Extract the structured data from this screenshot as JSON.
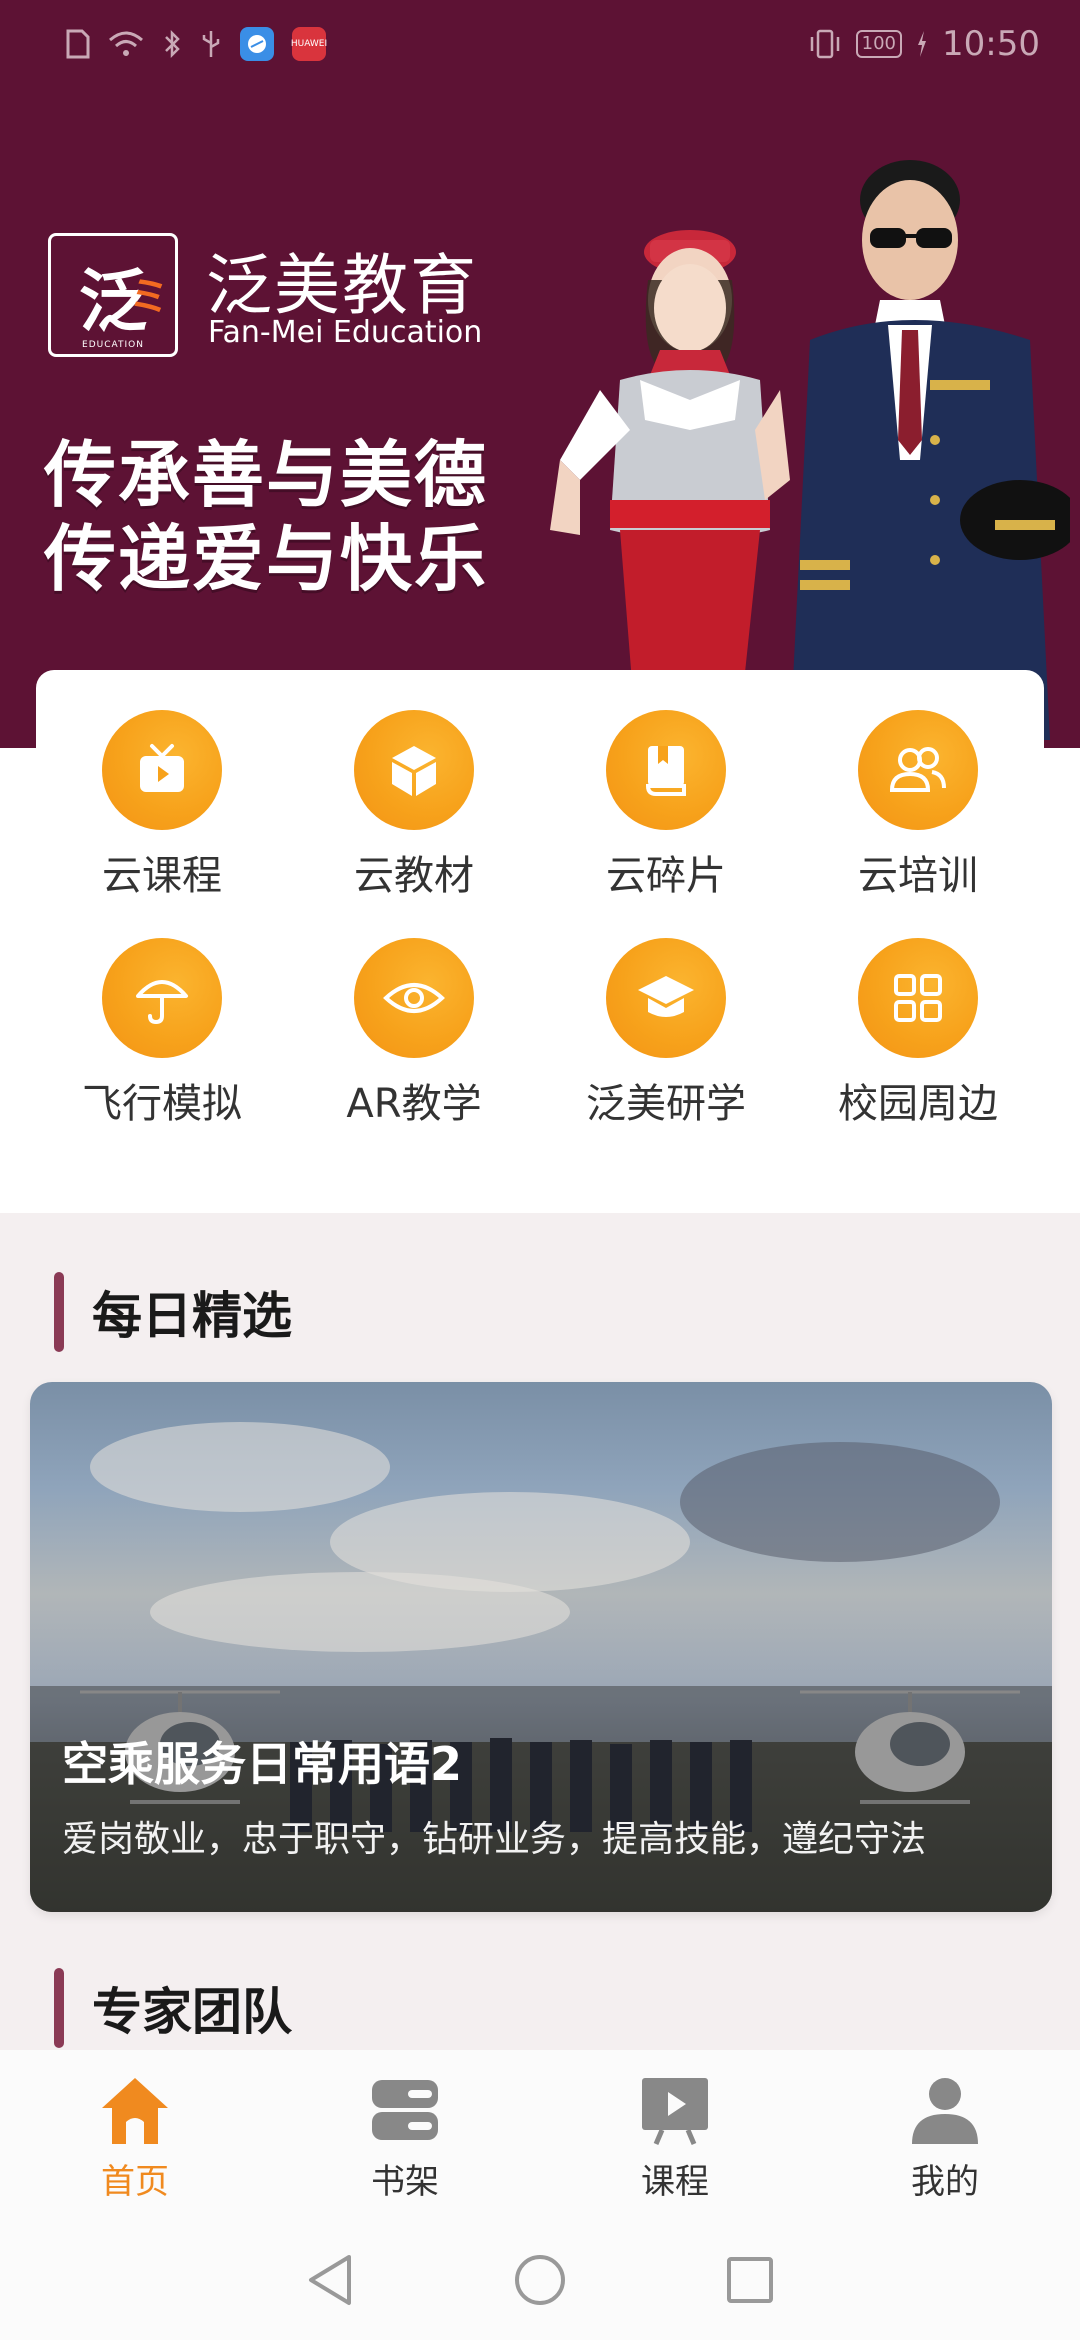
{
  "status_bar": {
    "time": "10:50",
    "battery": "100",
    "huawei_badge": "HUAWEI"
  },
  "banner": {
    "logo_char": "泛",
    "logo_sub": "EDUCATION",
    "brand_cn": "泛美教育",
    "brand_en": "Fan-Mei Education",
    "slogan_line1": "传承善与美德",
    "slogan_line2": "传递爱与快乐",
    "background_color": "#5d1234"
  },
  "menu": {
    "items": [
      {
        "label": "云课程",
        "icon": "tv-icon"
      },
      {
        "label": "云教材",
        "icon": "box-icon"
      },
      {
        "label": "云碎片",
        "icon": "book-icon"
      },
      {
        "label": "云培训",
        "icon": "users-icon"
      },
      {
        "label": "飞行模拟",
        "icon": "umbrella-icon"
      },
      {
        "label": "AR教学",
        "icon": "eye-icon"
      },
      {
        "label": "泛美研学",
        "icon": "graduation-cap-icon"
      },
      {
        "label": "校园周边",
        "icon": "grid-icon"
      }
    ],
    "icon_color": "#f7a21b"
  },
  "daily": {
    "title": "每日精选",
    "feature_title": "空乘服务日常用语2",
    "feature_subtitle": "爱岗敬业，忠于职守，钻研业务，提高技能，遵纪守法"
  },
  "experts": {
    "title": "专家团队"
  },
  "bottom_nav": {
    "items": [
      {
        "label": "首页",
        "icon": "home-icon",
        "active": true
      },
      {
        "label": "书架",
        "icon": "bookshelf-icon",
        "active": false
      },
      {
        "label": "课程",
        "icon": "course-icon",
        "active": false
      },
      {
        "label": "我的",
        "icon": "profile-icon",
        "active": false
      }
    ],
    "active_color": "#f08a1f",
    "inactive_color": "#888888"
  }
}
